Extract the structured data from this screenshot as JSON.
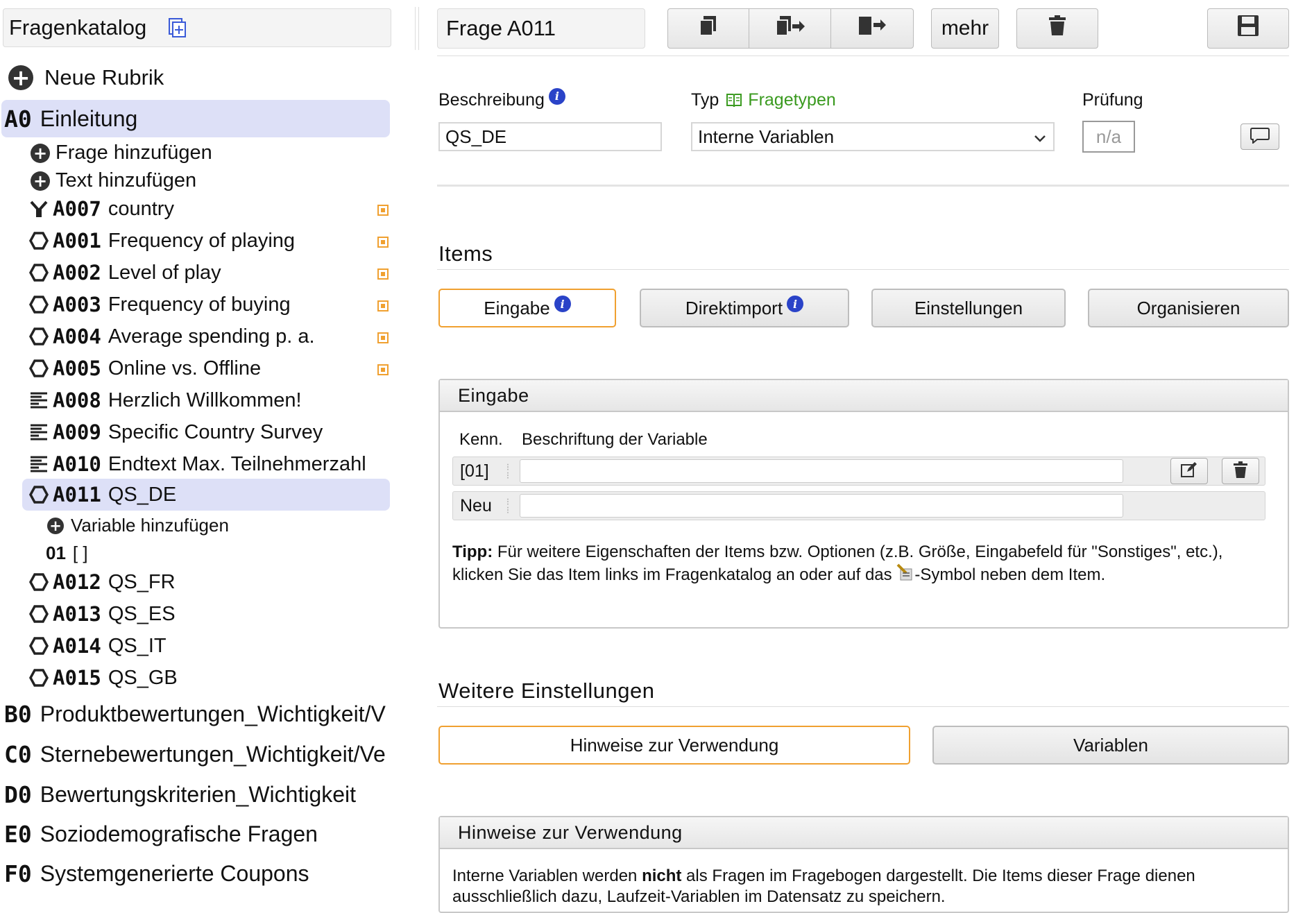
{
  "catalog": {
    "title": "Fragenkatalog",
    "new_rubric": "Neue Rubrik",
    "rubrics_top": [
      {
        "code": "A0",
        "label": "Einleitung"
      }
    ],
    "add_question": "Frage hinzufügen",
    "add_text": "Text hinzufügen",
    "questions": [
      {
        "code": "A007",
        "label": "country",
        "icon": "branch-icon",
        "flag": true
      },
      {
        "code": "A001",
        "label": "Frequency of playing",
        "icon": "question-icon",
        "flag": true
      },
      {
        "code": "A002",
        "label": "Level of play",
        "icon": "question-icon",
        "flag": true
      },
      {
        "code": "A003",
        "label": "Frequency of buying",
        "icon": "question-icon",
        "flag": true
      },
      {
        "code": "A004",
        "label": "Average spending p. a.",
        "icon": "question-icon",
        "flag": true
      },
      {
        "code": "A005",
        "label": "Online vs. Offline",
        "icon": "question-icon",
        "flag": true
      },
      {
        "code": "A008",
        "label": "Herzlich Willkommen!",
        "icon": "text-icon",
        "flag": false
      },
      {
        "code": "A009",
        "label": "Specific Country Survey",
        "icon": "text-icon",
        "flag": false
      },
      {
        "code": "A010",
        "label": "Endtext Max. Teilnehmerzahl",
        "icon": "text-icon",
        "flag": false
      },
      {
        "code": "A011",
        "label": "QS_DE",
        "icon": "question-icon",
        "flag": false
      }
    ],
    "add_variable": "Variable hinzufügen",
    "variable": {
      "code": "01",
      "label": "[ ]"
    },
    "questions_after": [
      {
        "code": "A012",
        "label": "QS_FR"
      },
      {
        "code": "A013",
        "label": "QS_ES"
      },
      {
        "code": "A014",
        "label": "QS_IT"
      },
      {
        "code": "A015",
        "label": "QS_GB"
      }
    ],
    "rubrics_bottom": [
      {
        "code": "B0",
        "label": "Produktbewertungen_Wichtigkeit/V"
      },
      {
        "code": "C0",
        "label": "Sternebewertungen_Wichtigkeit/Ve"
      },
      {
        "code": "D0",
        "label": "Bewertungskriterien_Wichtigkeit"
      },
      {
        "code": "E0",
        "label": "Soziodemografische Fragen"
      },
      {
        "code": "F0",
        "label": "Systemgenerierte Coupons"
      }
    ]
  },
  "toolbar": {
    "question_title": "Frage A011",
    "more_label": "mehr"
  },
  "form": {
    "description_label": "Beschreibung",
    "description_value": "QS_DE",
    "type_label": "Typ",
    "type_link": "Fragetypen",
    "type_value": "Interne Variablen",
    "check_label": "Prüfung",
    "check_value": "n/a"
  },
  "items": {
    "title": "Items",
    "tabs": [
      {
        "label": "Eingabe",
        "info": true,
        "active": true
      },
      {
        "label": "Direktimport",
        "info": true,
        "active": false
      },
      {
        "label": "Einstellungen",
        "info": false,
        "active": false
      },
      {
        "label": "Organisieren",
        "info": false,
        "active": false
      }
    ],
    "panel_title": "Eingabe",
    "col_id": "Kenn.",
    "col_label": "Beschriftung der Variable",
    "rows": [
      {
        "id": "[01]",
        "value": ""
      },
      {
        "id": "Neu",
        "value": ""
      }
    ],
    "tip_bold": "Tipp:",
    "tip_text_1": " Für weitere Eigenschaften der Items bzw. Optionen (z.B. Größe, Eingabefeld für \"Sonstiges\", etc.), klicken Sie das Item links im Fragenkatalog an oder auf das ",
    "tip_text_2": "-Symbol neben dem Item."
  },
  "more_settings": {
    "title": "Weitere Einstellungen",
    "tabs": [
      {
        "label": "Hinweise zur Verwendung",
        "active": true
      },
      {
        "label": "Variablen",
        "active": false
      }
    ],
    "panel_title": "Hinweise zur Verwendung",
    "hint_1": "Interne Variablen werden ",
    "hint_bold": "nicht",
    "hint_2": " als Fragen im Fragebogen dargestellt. Die Items dieser Frage dienen ausschließlich dazu, Laufzeit-Variablen im Datensatz zu speichern."
  },
  "colors": {
    "highlight": "#dde0f7",
    "accent_orange": "#f0a030",
    "link_green": "#3a9a1f",
    "info_blue": "#2a43c8"
  }
}
